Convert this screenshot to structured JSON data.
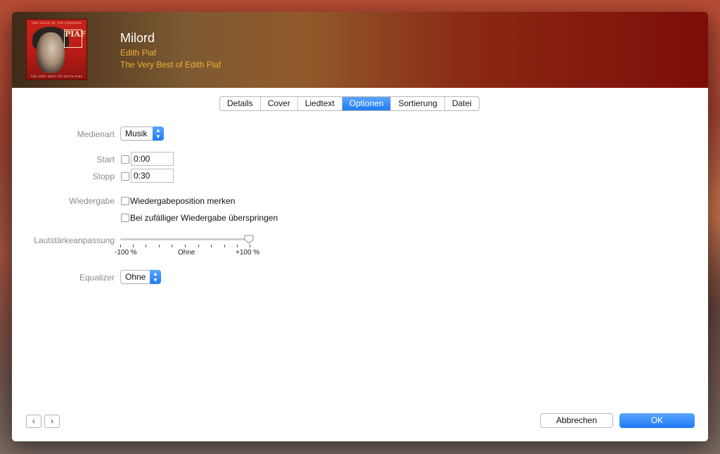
{
  "header": {
    "song_title": "Milord",
    "artist": "Edith Piaf",
    "album": "The Very Best of Edith Piaf",
    "cover": {
      "top_text": "THE VOICE OF THE SPARROW",
      "badge_text": "PIAF",
      "bottom_text": "THE VERY BEST OF EDITH PIAF"
    }
  },
  "tabs": [
    {
      "label": "Details",
      "active": false
    },
    {
      "label": "Cover",
      "active": false
    },
    {
      "label": "Liedtext",
      "active": false
    },
    {
      "label": "Optionen",
      "active": true
    },
    {
      "label": "Sortierung",
      "active": false
    },
    {
      "label": "Datei",
      "active": false
    }
  ],
  "options": {
    "media_kind_label": "Medienart",
    "media_kind_value": "Musik",
    "start_label": "Start",
    "start_value": "0:00",
    "start_checked": false,
    "stop_label": "Stopp",
    "stop_value": "0:30",
    "stop_checked": false,
    "playback_label": "Wiedergabe",
    "remember_position_label": "Wiedergabeposition merken",
    "remember_position_checked": false,
    "skip_shuffle_label": "Bei zufälliger Wiedergabe überspringen",
    "skip_shuffle_checked": false,
    "volume_label": "Lautstärkeanpassung",
    "volume_min_label": "-100 %",
    "volume_mid_label": "Ohne",
    "volume_max_label": "+100 %",
    "volume_percent": 100,
    "equalizer_label": "Equalizer",
    "equalizer_value": "Ohne"
  },
  "footer": {
    "prev_icon": "chevron-left-icon",
    "next_icon": "chevron-right-icon",
    "prev_glyph": "‹",
    "next_glyph": "›",
    "cancel_label": "Abbrechen",
    "ok_label": "OK"
  },
  "colors": {
    "accent": "#1f7cf5",
    "album_text": "#f0b03a"
  }
}
